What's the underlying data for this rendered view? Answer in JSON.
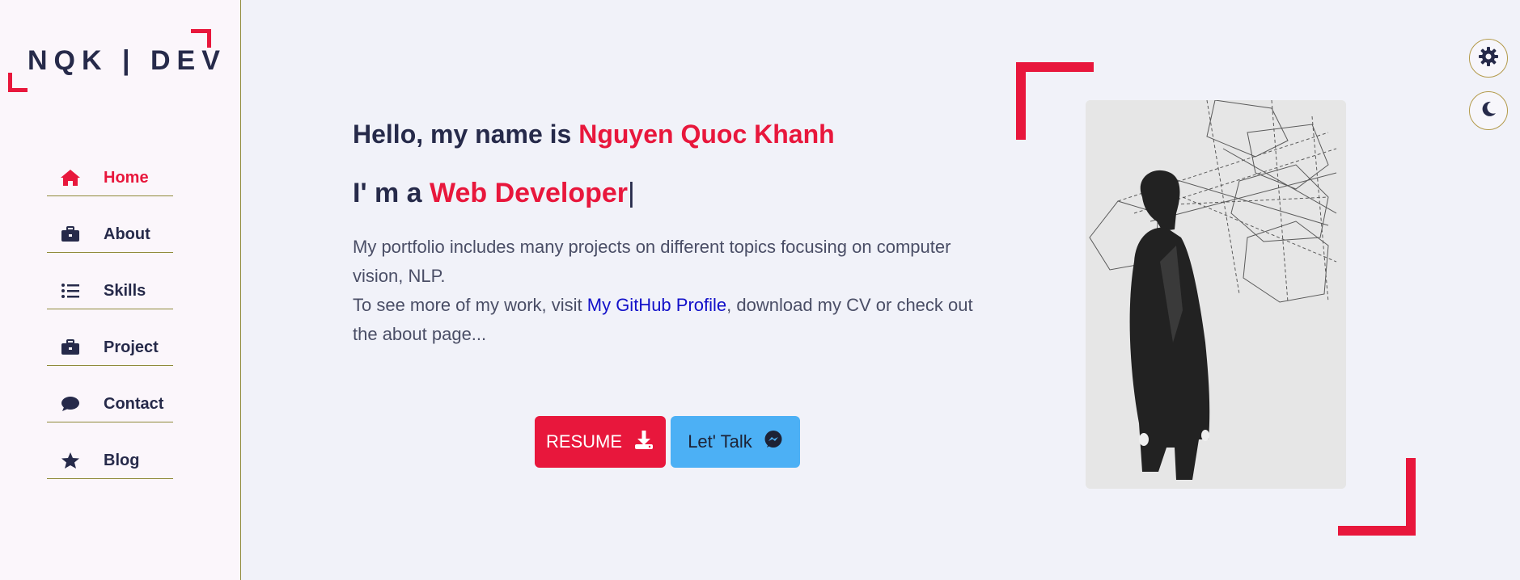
{
  "logo": {
    "text": "NQK | DEV"
  },
  "nav": {
    "items": [
      {
        "label": "Home",
        "icon": "home-icon",
        "active": true
      },
      {
        "label": "About",
        "icon": "briefcase-icon",
        "active": false
      },
      {
        "label": "Skills",
        "icon": "list-icon",
        "active": false
      },
      {
        "label": "Project",
        "icon": "briefcase-icon",
        "active": false
      },
      {
        "label": "Contact",
        "icon": "chat-bubble-icon",
        "active": false
      },
      {
        "label": "Blog",
        "icon": "star-icon",
        "active": false
      }
    ]
  },
  "hero": {
    "greeting_prefix": "Hello, my name is ",
    "name": "Nguyen Quoc Khanh",
    "role_prefix": "I' m a ",
    "role": "Web Developer",
    "cursor": "|",
    "desc_line1": "My portfolio includes many projects on different topics focusing on computer vision, NLP.",
    "desc_line2_prefix": "To see more of my work, visit ",
    "github_link": "My GitHub Profile",
    "desc_line2_suffix": ", download my CV or check out the about page..."
  },
  "buttons": {
    "resume_label": "RESUME",
    "talk_label": "Let' Talk"
  },
  "controls": {
    "settings_icon": "gear-icon",
    "theme_icon": "moon-icon"
  },
  "colors": {
    "accent": "#e8173c",
    "primary_text": "#262a4a",
    "talk_button": "#4cb0f5",
    "link": "#1210c9"
  }
}
